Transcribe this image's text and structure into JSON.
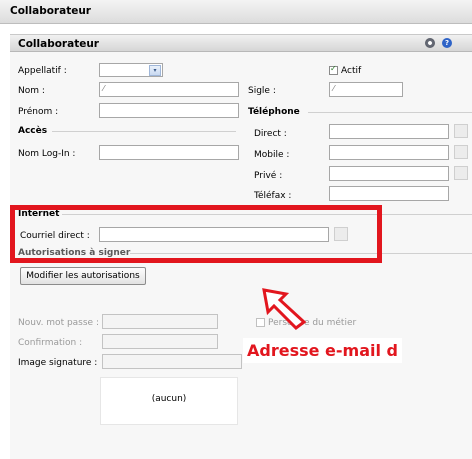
{
  "window": {
    "title": "Collaborateur"
  },
  "panel": {
    "title": "Collaborateur"
  },
  "form": {
    "appellatif_label": "Appellatif :",
    "actif_label": "Actif",
    "nom_label": "Nom :",
    "sigle_label": "Sigle :",
    "prenom_label": "Prénom :",
    "telephone_section": "Téléphone",
    "acces_section": "Accès",
    "direct_label": "Direct :",
    "nom_login_label": "Nom Log-In :",
    "mobile_label": "Mobile :",
    "prive_label": "Privé :",
    "telefax_label": "Téléfax :",
    "internet_section": "Internet",
    "courriel_label": "Courriel direct :",
    "autorisations_section": "Autorisations à signer",
    "modifier_button": "Modifier les autorisations",
    "nouv_mot_passe_label": "Nouv. mot passe :",
    "confirmation_label": "Confirmation :",
    "image_signature_label": "Image signature :",
    "personne_label": "Personne du métier",
    "image_placeholder": "(aucun)"
  },
  "annotation": {
    "text": "Adresse e-mail d"
  },
  "colors": {
    "highlight": "#e2161e"
  },
  "icons": [
    "gear-icon",
    "help-icon",
    "dropdown-arrow-icon",
    "edit-pen-icon",
    "annotation-arrow-icon"
  ]
}
